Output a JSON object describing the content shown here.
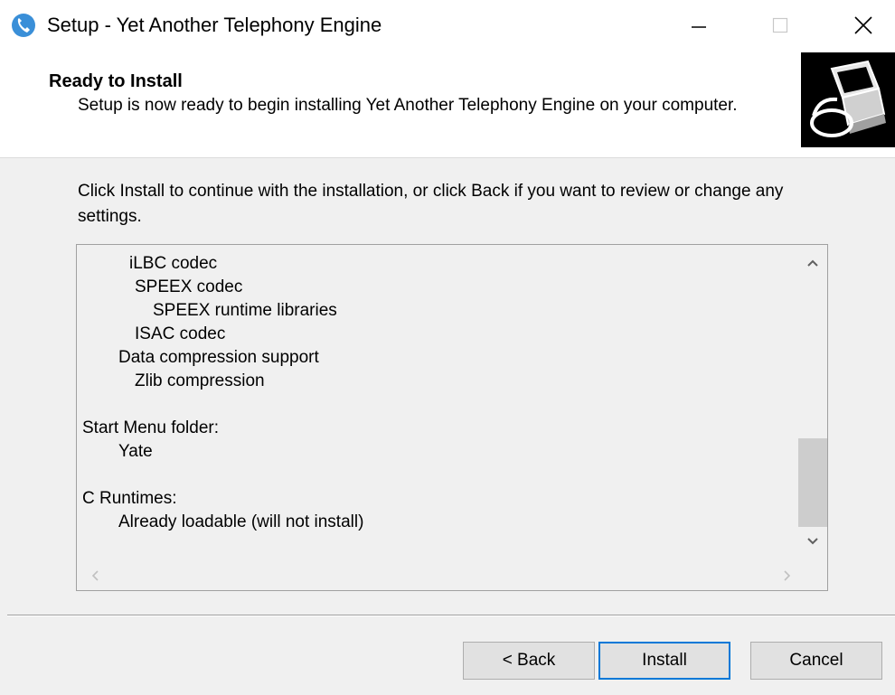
{
  "window": {
    "title": "Setup - Yet Another Telephony Engine"
  },
  "header": {
    "title": "Ready to Install",
    "subtitle": "Setup is now ready to begin installing Yet Another Telephony Engine on your computer."
  },
  "main": {
    "intro": "Click Install to continue with the installation, or click Back if you want to review or change any settings.",
    "memo_lines": [
      {
        "text": "iLBC codec"
      },
      {
        "text": "SPEEX codec"
      },
      {
        "text": "SPEEX runtime libraries"
      },
      {
        "text": "ISAC codec"
      },
      {
        "text": "Data compression support"
      },
      {
        "text": "Zlib compression"
      },
      {
        "text": ""
      },
      {
        "text": "Start Menu folder:"
      },
      {
        "text": "Yate"
      },
      {
        "text": ""
      },
      {
        "text": "C Runtimes:"
      },
      {
        "text": "Already loadable (will not install)"
      }
    ]
  },
  "footer": {
    "back_label": "< Back",
    "install_label": "Install",
    "cancel_label": "Cancel"
  },
  "icons": {
    "app": "yate-app-icon",
    "header": "computer-install-icon"
  },
  "colors": {
    "default_button_border": "#0078d7",
    "window_background": "#f0f0f0"
  }
}
